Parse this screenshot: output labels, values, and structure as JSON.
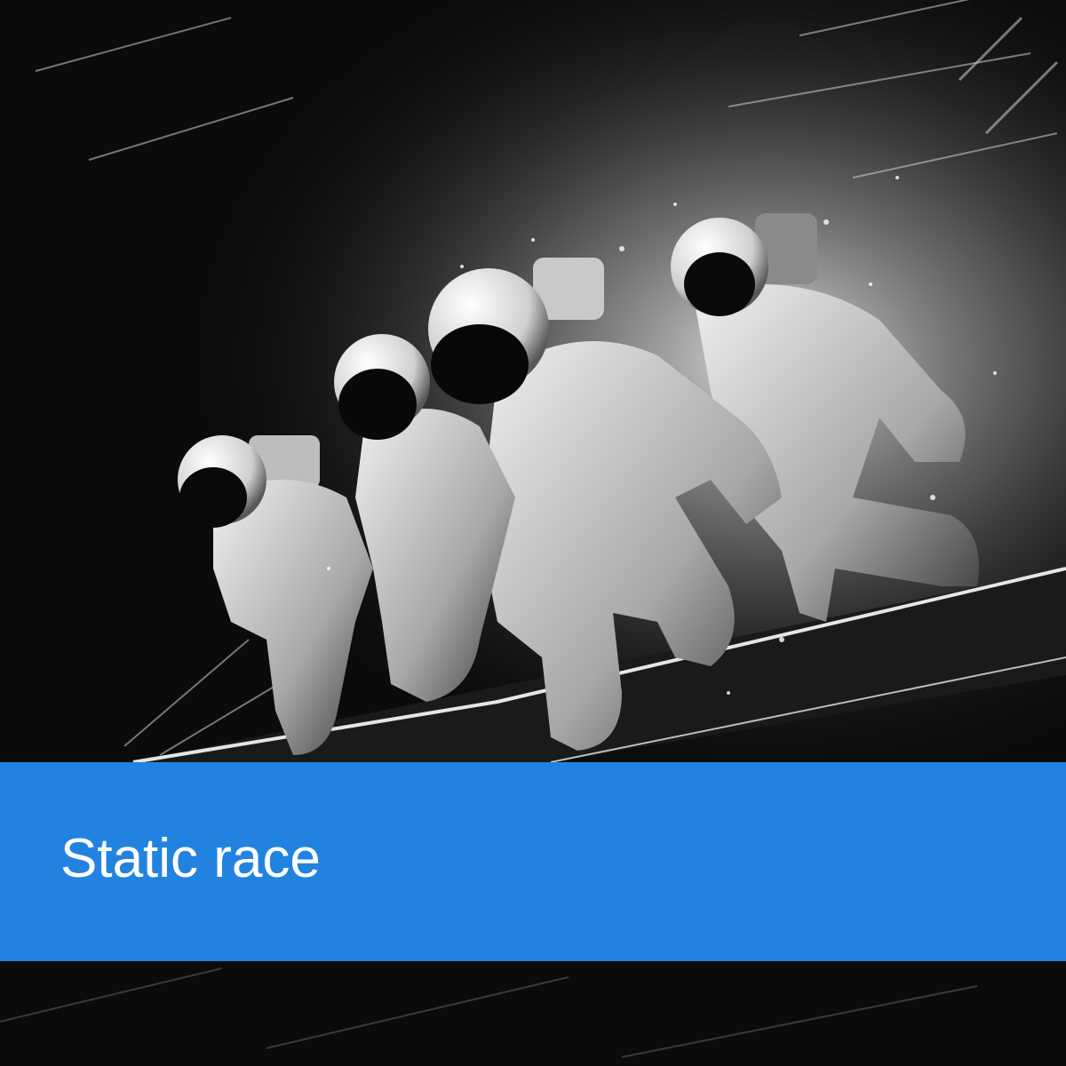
{
  "illustration": {
    "subject": "astronauts-icon",
    "style": "monochrome",
    "figure_count": 4
  },
  "banner": {
    "title": "Static race",
    "color": "#2183DF",
    "text_color": "#FFFFFF"
  },
  "colors": {
    "background": "#0B0B0B",
    "highlight": "#F2F2F2"
  }
}
